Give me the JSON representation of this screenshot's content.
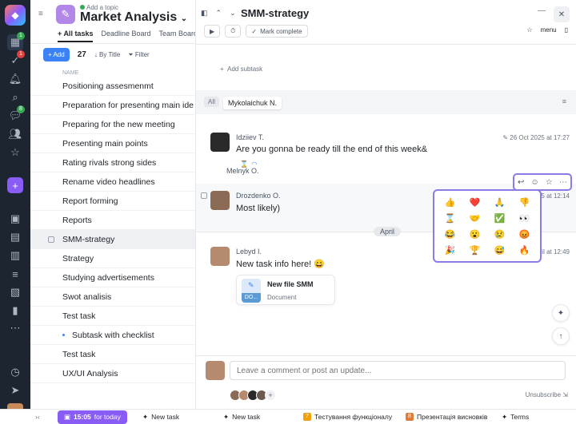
{
  "rail": {
    "badges": {
      "chat": "1",
      "checks": "1",
      "messages": "8"
    }
  },
  "project": {
    "add_topic": "Add a topic",
    "title": "Market Analysis"
  },
  "tabs": [
    "All tasks",
    "Deadline Board",
    "Team Board"
  ],
  "toolbar": {
    "add_label": "Add",
    "count": "27",
    "sort_label": "By Title",
    "filter_label": "Filter",
    "column_header": "NAME"
  },
  "tasks": [
    {
      "label": "Positioning assesmenmt"
    },
    {
      "label": "Preparation for presenting main ide"
    },
    {
      "label": "Preparing for the new meeting"
    },
    {
      "label": "Presenting main points"
    },
    {
      "label": "Rating rivals strong sides"
    },
    {
      "label": "Rename video headlines"
    },
    {
      "label": "Report forming"
    },
    {
      "label": "Reports"
    },
    {
      "label": "SMM-strategy"
    },
    {
      "label": "Strategy"
    },
    {
      "label": "Studying advertisements"
    },
    {
      "label": "Swot analisis"
    },
    {
      "label": "Test task"
    },
    {
      "label": "Subtask with checklist"
    },
    {
      "label": "Test task"
    },
    {
      "label": "UX/UI Analysis"
    }
  ],
  "panel": {
    "title": "SMM-strategy",
    "mark_complete": "Mark complete",
    "menu_label": "menu",
    "add_subtask": "Add subtask",
    "filter_all": "All",
    "filter_user": "Mykolaichuk N.",
    "april": "April"
  },
  "messages": [
    {
      "author": "Idziiev T.",
      "text": "Are you gonna be ready till the end of this week&",
      "date": "26 Oct 2025 at 17:27",
      "reaction_user": "Melnyk O."
    },
    {
      "author": "Drozdenko O.",
      "text": "Most likely)",
      "date": "25 at 12:14"
    },
    {
      "author": "Lebyd I.",
      "text": "New task info here! 😄",
      "date": "ril at 12:49"
    }
  ],
  "file": {
    "name": "New file SMM",
    "type": "Document",
    "badge": "DO..."
  },
  "emojis": [
    "👍",
    "❤️",
    "🙏",
    "👎",
    "⌛",
    "🤝",
    "✅",
    "👀",
    "😂",
    "😮",
    "😢",
    "😡",
    "🎉",
    "🏆",
    "😅",
    "🔥"
  ],
  "compose": {
    "placeholder": "Leave a comment or post an update...",
    "unsubscribe": "Unsubscribe"
  },
  "bottom": {
    "timer": "15:05",
    "timer_suffix": "for today",
    "new_task_1": "New task",
    "new_task_2": "New task",
    "item_3_num": "7",
    "item_3": "Тестування функціоналу",
    "item_4_num": "8",
    "item_4": "Презентація висновків",
    "item_5": "Terms"
  },
  "colors": {
    "accent": "#8a5cf6",
    "primary": "#3b82f6",
    "rail": "#1d2531"
  }
}
